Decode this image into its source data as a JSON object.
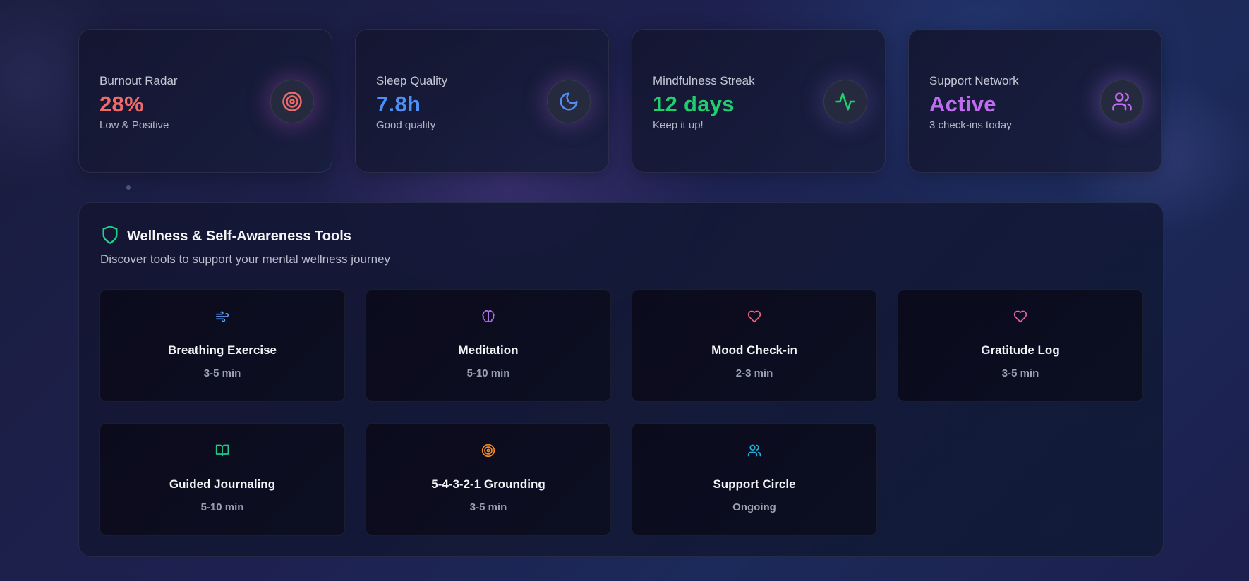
{
  "stats": [
    {
      "label": "Burnout Radar",
      "value": "28%",
      "sub": "Low & Positive",
      "icon": "target-icon",
      "color": "#f06a6a"
    },
    {
      "label": "Sleep Quality",
      "value": "7.8h",
      "sub": "Good quality",
      "icon": "moon-icon",
      "color": "#4d8ff5"
    },
    {
      "label": "Mindfulness Streak",
      "value": "12 days",
      "sub": "Keep it up!",
      "icon": "activity-icon",
      "color": "#1fcf6e"
    },
    {
      "label": "Support Network",
      "value": "Active",
      "sub": "3 check-ins today",
      "icon": "users-icon",
      "color": "#c06cf0"
    }
  ],
  "tools_panel": {
    "title": "Wellness & Self-Awareness Tools",
    "subtitle": "Discover tools to support your mental wellness journey",
    "icon": "shield-icon",
    "icon_color": "#1fcf8a"
  },
  "tools": [
    {
      "name": "Breathing Exercise",
      "duration": "3-5 min",
      "icon": "wind-icon",
      "color": "#5b9cf5"
    },
    {
      "name": "Meditation",
      "duration": "5-10 min",
      "icon": "brain-icon",
      "color": "#b071ea"
    },
    {
      "name": "Mood Check-in",
      "duration": "2-3 min",
      "icon": "heart-icon",
      "color": "#f0607e"
    },
    {
      "name": "Gratitude Log",
      "duration": "3-5 min",
      "icon": "heart-icon",
      "color": "#ec5fa0"
    },
    {
      "name": "Guided Journaling",
      "duration": "5-10 min",
      "icon": "book-open-icon",
      "color": "#22c98a"
    },
    {
      "name": "5-4-3-2-1 Grounding",
      "duration": "3-5 min",
      "icon": "target-icon",
      "color": "#f58a22"
    },
    {
      "name": "Support Circle",
      "duration": "Ongoing",
      "icon": "users-icon",
      "color": "#22b0d8"
    }
  ]
}
